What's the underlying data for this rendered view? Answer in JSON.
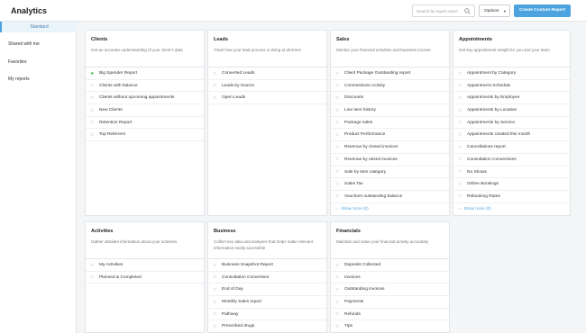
{
  "header": {
    "title": "Analytics",
    "search_placeholder": "Search by report name",
    "options_label": "Options",
    "create_label": "Create Custom Report"
  },
  "sidebar": {
    "items": [
      {
        "label": "Standard",
        "active": true
      },
      {
        "label": "Shared with me"
      },
      {
        "label": "Favorites"
      },
      {
        "label": "My reports"
      }
    ]
  },
  "cards": {
    "clients": {
      "title": "Clients",
      "description": "Get an accurate understanding of your client's data",
      "items": [
        {
          "label": "Big Spender Report",
          "favorite": true
        },
        {
          "label": "Clients with balance"
        },
        {
          "label": "Clients without upcoming appointments"
        },
        {
          "label": "New Clients"
        },
        {
          "label": "Retention Report"
        },
        {
          "label": "Top Referrers"
        }
      ]
    },
    "leads": {
      "title": "Leads",
      "description": "Track how your lead process is doing at all times",
      "items": [
        {
          "label": "Converted Leads"
        },
        {
          "label": "Leads by Source"
        },
        {
          "label": "Open Leads"
        }
      ]
    },
    "sales": {
      "title": "Sales",
      "description": "Monitor your financial activities and business income",
      "items": [
        {
          "label": "Client Package Outstanding report"
        },
        {
          "label": "Commissions Activity"
        },
        {
          "label": "Discounts"
        },
        {
          "label": "Line item history"
        },
        {
          "label": "Package sales"
        },
        {
          "label": "Product Performance"
        },
        {
          "label": "Revenue by closed invoices"
        },
        {
          "label": "Revenue by raised invoices"
        },
        {
          "label": "Sale by item category"
        },
        {
          "label": "Sales Tax"
        },
        {
          "label": "Vouchers outstanding balance"
        }
      ],
      "show_more": "Show more (0)"
    },
    "appointments": {
      "title": "Appointments",
      "description": "Get key appointment insight for you and your team",
      "items": [
        {
          "label": "Appointment by Category"
        },
        {
          "label": "Appointment Schedule"
        },
        {
          "label": "Appointments by Employee"
        },
        {
          "label": "Appointments by Location"
        },
        {
          "label": "Appointments by Service"
        },
        {
          "label": "Appointments created this month"
        },
        {
          "label": "Cancellations report"
        },
        {
          "label": "Consultation Conversions"
        },
        {
          "label": "No Shows"
        },
        {
          "label": "Online Bookings"
        },
        {
          "label": "Rebooking Rates"
        }
      ],
      "show_more": "Show more (0)"
    },
    "activities": {
      "title": "Activities",
      "description": "Gather detailed information about your activities",
      "items": [
        {
          "label": "My Activities"
        },
        {
          "label": "Planned & Completed"
        }
      ]
    },
    "business": {
      "title": "Business",
      "description": "Collect key data and analyses that helps make relevant information easily accessible",
      "items": [
        {
          "label": "Business Snapshot Report"
        },
        {
          "label": "Consultation Conversion"
        },
        {
          "label": "End of Day"
        },
        {
          "label": "Monthly Sales report"
        },
        {
          "label": "Pathway"
        },
        {
          "label": "Prescribed drugs"
        }
      ]
    },
    "financials": {
      "title": "Financials",
      "description": "Maintain and value your financial activity accurately",
      "items": [
        {
          "label": "Deposits Collected"
        },
        {
          "label": "Invoices"
        },
        {
          "label": "Outstanding invoices"
        },
        {
          "label": "Payments"
        },
        {
          "label": "Refunds"
        },
        {
          "label": "Tips"
        }
      ]
    }
  },
  "icons": {
    "star": "star-outline-icon",
    "star_favorite": "star-filled-icon",
    "search": "search-icon",
    "caret": "chevron-down-icon"
  },
  "colors": {
    "accent": "#4da3e0",
    "favorite": "#2eb82e",
    "active_nav_bg": "#eaf4fb"
  }
}
